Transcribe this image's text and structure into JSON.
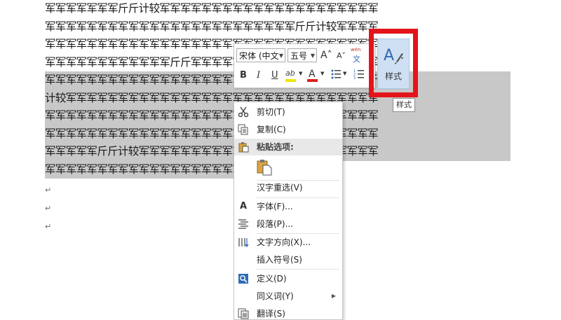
{
  "document": {
    "lines": [
      "军军军军军军军斤斤计较军军军军军军军军军军军军军军军军军军军军军",
      "军军军军军军军军军军军军军军军军军军军军军军军军斤斤计较军军军军",
      "军军军军军军军军军军军军军军军军军军军军军军军军军军军军军军军军",
      "军军军军军军军军军军军军斤斤军军军军军军军军军军军军军军军军军军",
      "军军军军军军军军军军军军军军军军军军军军军军军军军军军军军军斤斤",
      "计较军军军军军军军军军军军军军军军军军军军军军军军军军军军军军军",
      "军军军军军军军军军军军军军军军军军军军军军军军军军军军军军军军军",
      "军军军军军军军军军军军军军军军军军军军军军军军军军军军军军军军军",
      "军军军军军斤斤计较军军军军军军军军军军军军军军军军军军军军军军军",
      "军军军军军军军军军军军军军军军军军军军军军军军"
    ],
    "paragraph_mark": "↵"
  },
  "mini_toolbar": {
    "font_name": "宋体 (中文",
    "font_size": "五号",
    "grow_font_icon": "A˄",
    "shrink_font_icon": "A˅",
    "phonetic_top": "wén",
    "phonetic_bottom": "文",
    "bold": "B",
    "italic": "I",
    "underline": "U",
    "highlight_icon": "ab",
    "font_color_icon": "A",
    "styles_label": "样式",
    "colors": {
      "highlight": "#f2e600",
      "font_color": "#e01e1e",
      "accent": "#2e6bb5"
    }
  },
  "tooltip": "样式",
  "context_menu": {
    "items": [
      {
        "icon": "cut-icon",
        "label": "剪切(T)"
      },
      {
        "icon": "copy-icon",
        "label": "复制(C)"
      },
      {
        "icon": "paste-icon",
        "label": "粘贴选项:"
      },
      {
        "icon": "paste-keep-text-icon",
        "label": ""
      },
      {
        "icon": "",
        "label": "汉字重选(V)"
      },
      {
        "icon": "font-icon",
        "label": "字体(F)..."
      },
      {
        "icon": "paragraph-icon",
        "label": "段落(P)..."
      },
      {
        "icon": "text-direction-icon",
        "label": "文字方向(X)..."
      },
      {
        "icon": "",
        "label": "插入符号(S)"
      },
      {
        "icon": "define-icon",
        "label": "定义(D)"
      },
      {
        "icon": "",
        "label": "同义词(Y)"
      },
      {
        "icon": "translate-icon",
        "label": "翻译(S)"
      }
    ]
  },
  "highlight_color": "#e4141b",
  "selection_color": "#c8c8c8"
}
